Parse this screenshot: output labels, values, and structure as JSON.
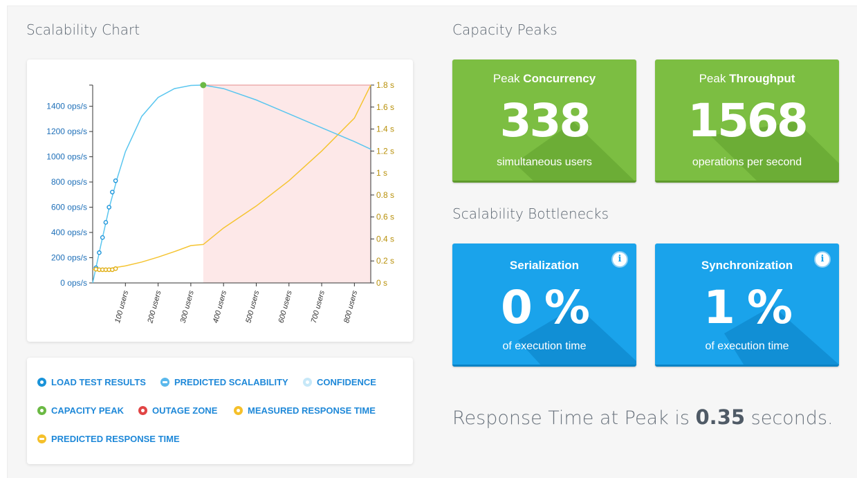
{
  "titles": {
    "chart": "Scalability Chart",
    "peaks": "Capacity Peaks",
    "bottlenecks": "Scalability Bottlenecks"
  },
  "peaks": [
    {
      "prefix": "Peak",
      "bold": "Concurrency",
      "value": "338",
      "sub": "simultaneous users"
    },
    {
      "prefix": "Peak",
      "bold": "Throughput",
      "value": "1568",
      "sub": "operations per second"
    }
  ],
  "bottlenecks": [
    {
      "label": "Serialization",
      "value": "0 %",
      "sub": "of execution time",
      "info": "i"
    },
    {
      "label": "Synchronization",
      "value": "1 %",
      "sub": "of execution time",
      "info": "i"
    }
  ],
  "response": {
    "prefix": "Response Time at Peak is",
    "value": "0.35",
    "suffix": "seconds."
  },
  "legend": [
    {
      "label": "LOAD TEST RESULTS",
      "color": "#1a93d9",
      "shape": "dot"
    },
    {
      "label": "PREDICTED SCALABILITY",
      "color": "#5ab8ec",
      "shape": "bar"
    },
    {
      "label": "CONFIDENCE",
      "color": "#c7e8f8",
      "shape": "dot"
    },
    {
      "label": "CAPACITY PEAK",
      "color": "#6bb944",
      "shape": "dot"
    },
    {
      "label": "OUTAGE ZONE",
      "color": "#e14545",
      "shape": "dot"
    },
    {
      "label": "MEASURED RESPONSE TIME",
      "color": "#f5c02a",
      "shape": "dot"
    },
    {
      "label": "PREDICTED RESPONSE TIME",
      "color": "#f5c02a",
      "shape": "bar"
    }
  ],
  "colors": {
    "throughput": "#5ac6ef",
    "throughput_axis": "#1e6fb8",
    "response": "#f5c431",
    "response_axis": "#b8900a",
    "outage": "#fde8e8",
    "outage_line": "#e48a8a",
    "peak": "#6bb944"
  },
  "chart_data": {
    "type": "line",
    "x_unit": "users",
    "xlim": [
      0,
      850
    ],
    "x_ticks": [
      100,
      200,
      300,
      400,
      500,
      600,
      700,
      800
    ],
    "x_tick_labels": [
      "100 users",
      "200 users",
      "300 users",
      "400 users",
      "500 users",
      "600 users",
      "700 users",
      "800 users"
    ],
    "y_left": {
      "lim": [
        0,
        1568
      ],
      "ticks": [
        0,
        200,
        400,
        600,
        800,
        1000,
        1200,
        1400
      ],
      "tick_labels": [
        "0 ops/s",
        "200 ops/s",
        "400 ops/s",
        "600 ops/s",
        "800 ops/s",
        "1000 ops/s",
        "1200 ops/s",
        "1400 ops/s"
      ]
    },
    "y_right": {
      "lim": [
        0,
        1.8
      ],
      "ticks": [
        0,
        0.2,
        0.4,
        0.6,
        0.8,
        1.0,
        1.2,
        1.4,
        1.6,
        1.8
      ],
      "tick_labels": [
        "0 s",
        "0.2 s",
        "0.4 s",
        "0.6 s",
        "0.8 s",
        "1 s",
        "1.2 s",
        "1.4 s",
        "1.6 s",
        "1.8 s"
      ]
    },
    "capacity_peak": {
      "x": 338,
      "y": 1568
    },
    "outage_zone": {
      "x_start": 338,
      "x_end": 850
    },
    "series": [
      {
        "name": "LOAD TEST RESULTS",
        "axis": "left",
        "points": [
          [
            10,
            120
          ],
          [
            20,
            240
          ],
          [
            30,
            360
          ],
          [
            40,
            480
          ],
          [
            50,
            600
          ],
          [
            60,
            720
          ],
          [
            70,
            810
          ]
        ]
      },
      {
        "name": "PREDICTED SCALABILITY",
        "axis": "left",
        "points": [
          [
            0,
            0
          ],
          [
            25,
            300
          ],
          [
            50,
            590
          ],
          [
            75,
            830
          ],
          [
            100,
            1040
          ],
          [
            150,
            1320
          ],
          [
            200,
            1470
          ],
          [
            250,
            1540
          ],
          [
            300,
            1565
          ],
          [
            338,
            1568
          ],
          [
            400,
            1540
          ],
          [
            500,
            1450
          ],
          [
            600,
            1340
          ],
          [
            700,
            1230
          ],
          [
            800,
            1120
          ],
          [
            850,
            1060
          ]
        ]
      },
      {
        "name": "MEASURED RESPONSE TIME",
        "axis": "right",
        "points": [
          [
            10,
            0.125
          ],
          [
            20,
            0.12
          ],
          [
            30,
            0.12
          ],
          [
            40,
            0.12
          ],
          [
            50,
            0.12
          ],
          [
            60,
            0.12
          ],
          [
            70,
            0.13
          ]
        ]
      },
      {
        "name": "PREDICTED RESPONSE TIME",
        "axis": "right",
        "points": [
          [
            0,
            0.12
          ],
          [
            50,
            0.13
          ],
          [
            100,
            0.155
          ],
          [
            150,
            0.19
          ],
          [
            200,
            0.235
          ],
          [
            250,
            0.285
          ],
          [
            300,
            0.34
          ],
          [
            338,
            0.35
          ],
          [
            400,
            0.5
          ],
          [
            500,
            0.7
          ],
          [
            600,
            0.93
          ],
          [
            700,
            1.2
          ],
          [
            800,
            1.5
          ],
          [
            850,
            1.8
          ]
        ]
      }
    ]
  }
}
